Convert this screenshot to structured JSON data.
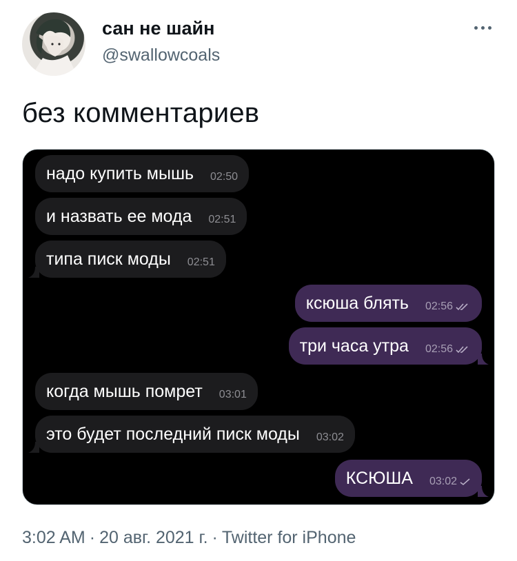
{
  "author": {
    "display_name": "сан не шайн",
    "handle": "@swallowcoals"
  },
  "tweet": {
    "text": "без комментариев"
  },
  "messages": [
    {
      "text": "надо купить мышь",
      "time": "02:50",
      "direction": "in"
    },
    {
      "text": "и назвать ее мода",
      "time": "02:51",
      "direction": "in"
    },
    {
      "text": "типа писк моды",
      "time": "02:51",
      "direction": "in"
    },
    {
      "text": "ксюша блять",
      "time": "02:56",
      "direction": "out",
      "status": "read"
    },
    {
      "text": "три часа утра",
      "time": "02:56",
      "direction": "out",
      "status": "read"
    },
    {
      "text": "когда мышь помрет",
      "time": "03:01",
      "direction": "in"
    },
    {
      "text": "это будет последний писк  моды",
      "time": "03:02",
      "direction": "in"
    },
    {
      "text": "КСЮША",
      "time": "03:02",
      "direction": "out",
      "status": "sent"
    }
  ],
  "meta": {
    "time": "3:02 AM",
    "date": "20 авг. 2021 г.",
    "source": "Twitter for iPhone"
  },
  "colors": {
    "incoming_bubble": "#1c1c1e",
    "outgoing_bubble": "#3f2a55",
    "chat_background": "#000000",
    "secondary_text": "#536471"
  },
  "icons": {
    "more": "more-horizontal-icon",
    "read": "double-check-icon",
    "sent": "single-check-icon"
  }
}
